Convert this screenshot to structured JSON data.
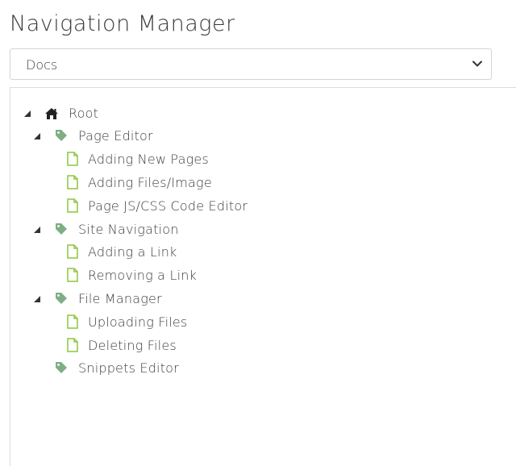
{
  "page": {
    "title": "Navigation Manager"
  },
  "selector": {
    "selected": "Docs"
  },
  "tree": {
    "root": {
      "label": "Root",
      "icon": "home-icon"
    },
    "sections": [
      {
        "label": "Page Editor",
        "icon": "tag-icon",
        "expanded": true,
        "pages": [
          {
            "label": "Adding New Pages",
            "icon": "file-icon"
          },
          {
            "label": "Adding Files/Image",
            "icon": "file-icon"
          },
          {
            "label": "Page JS/CSS Code Editor",
            "icon": "file-icon"
          }
        ]
      },
      {
        "label": "Site Navigation",
        "icon": "tag-icon",
        "expanded": true,
        "pages": [
          {
            "label": "Adding a Link",
            "icon": "file-icon"
          },
          {
            "label": "Removing a Link",
            "icon": "file-icon"
          }
        ]
      },
      {
        "label": "File Manager",
        "icon": "tag-icon",
        "expanded": true,
        "pages": [
          {
            "label": "Uploading Files",
            "icon": "file-icon"
          },
          {
            "label": "Deleting Files",
            "icon": "file-icon"
          }
        ]
      },
      {
        "label": "Snippets Editor",
        "icon": "tag-icon",
        "expanded": false,
        "pages": []
      }
    ]
  },
  "colors": {
    "tag_icon": "#7fae84",
    "file_icon": "#8cc63f",
    "home_icon": "#222222",
    "toggle": "#333333"
  }
}
